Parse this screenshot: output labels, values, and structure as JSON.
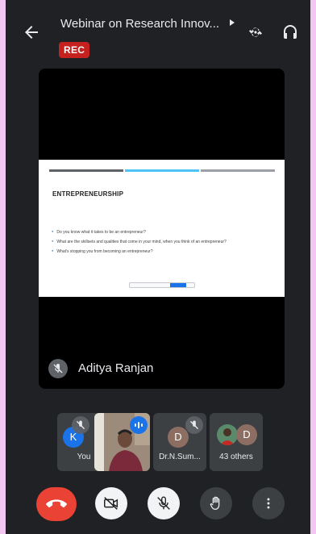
{
  "header": {
    "title": "Webinar on Research Innov...",
    "rec_badge": "REC",
    "icons": [
      "back-arrow-icon",
      "switch-camera-icon",
      "headphones-icon"
    ]
  },
  "presentation": {
    "slide_title": "ENTREPRENEURSHIP",
    "bullets": [
      "Do you know what it takes to be an entrepreneur?",
      "What are the skillsets and qualities that come in your mind, when you think of an entrepreneur?",
      "What's stopping you from becoming an entrepreneur?"
    ],
    "progress_colors": [
      "#5f6368",
      "#4fc3f7",
      "#9aa0a6"
    ]
  },
  "speaker": {
    "name": "Aditya Ranjan",
    "muted": true
  },
  "participants": [
    {
      "label": "You",
      "initial": "K",
      "avatar_color": "#1a73e8",
      "muted": true
    },
    {
      "label": "",
      "speaking": true
    },
    {
      "label": "Dr.N.Sum...",
      "initial": "D",
      "avatar_color": "#8d6e63",
      "muted": true
    },
    {
      "label": "43 others",
      "initial": "D",
      "avatar_color": "#8d6e63"
    }
  ],
  "controls": [
    "end-call-icon",
    "camera-off-icon",
    "mic-off-icon",
    "raise-hand-icon",
    "more-options-icon"
  ],
  "colors": {
    "background": "#202124",
    "end_call": "#ea4335",
    "rec": "#c5221f",
    "accent": "#1a73e8"
  }
}
